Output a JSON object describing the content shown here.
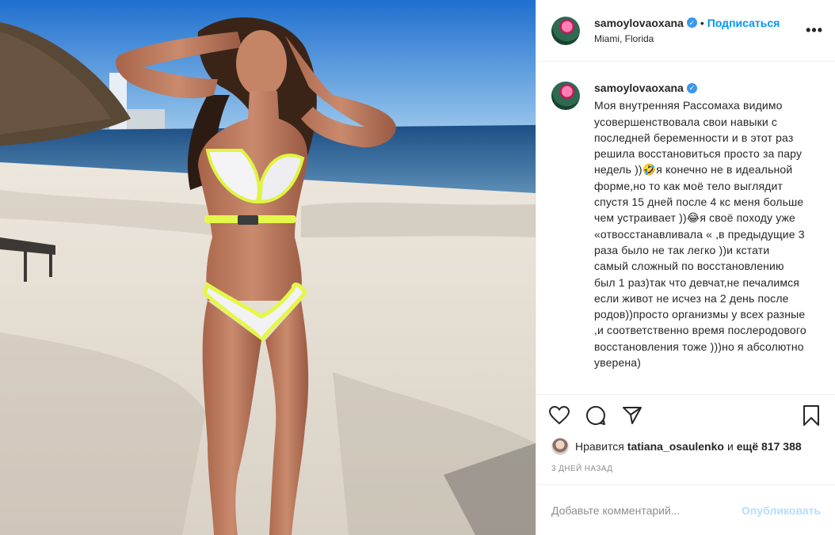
{
  "post": {
    "username": "samoylovaoxana",
    "verified_mark": "✓",
    "separator": "•",
    "follow_label": "Подписаться",
    "location": "Miami, Florida",
    "more_icon": "•••"
  },
  "caption": {
    "username": "samoylovaoxana",
    "text": "Моя внутренняя Рассомаха видимо усовершенствовала свои навыки с последней беременности и в этот раз решила восстановиться просто за пару недель ))🤣я конечно не в идеальной форме,но то как моё тело выглядит спустя 15 дней после 4 кс меня больше чем устраивает ))😂я своё походу уже «отвосстанавливала « ,в предыдущие 3 раза было не так легко ))и кстати самый сложный по восстановлению был 1 раз)так что девчат,не печалимся если живот не исчез на 2 день после родов))просто организмы у всех разные ,и соответственно время послеродового восстановления тоже )))но я абсолютно уверена)"
  },
  "actions": {
    "like_icon": "heart-icon",
    "comment_icon": "comment-icon",
    "share_icon": "share-icon",
    "save_icon": "bookmark-icon"
  },
  "likes": {
    "prefix": "Нравится",
    "user": "tatiana_osaulenko",
    "conjunction": "и",
    "rest": "ещё 817 388"
  },
  "timestamp": "3 ДНЕЙ НАЗАД",
  "comment": {
    "placeholder": "Добавьте комментарий...",
    "publish_label": "Опубликовать"
  },
  "colors": {
    "accent": "#0095f6",
    "publish_disabled": "#b2dffc",
    "verified": "#3897f0",
    "text": "#262626",
    "muted": "#8e8e8e"
  }
}
